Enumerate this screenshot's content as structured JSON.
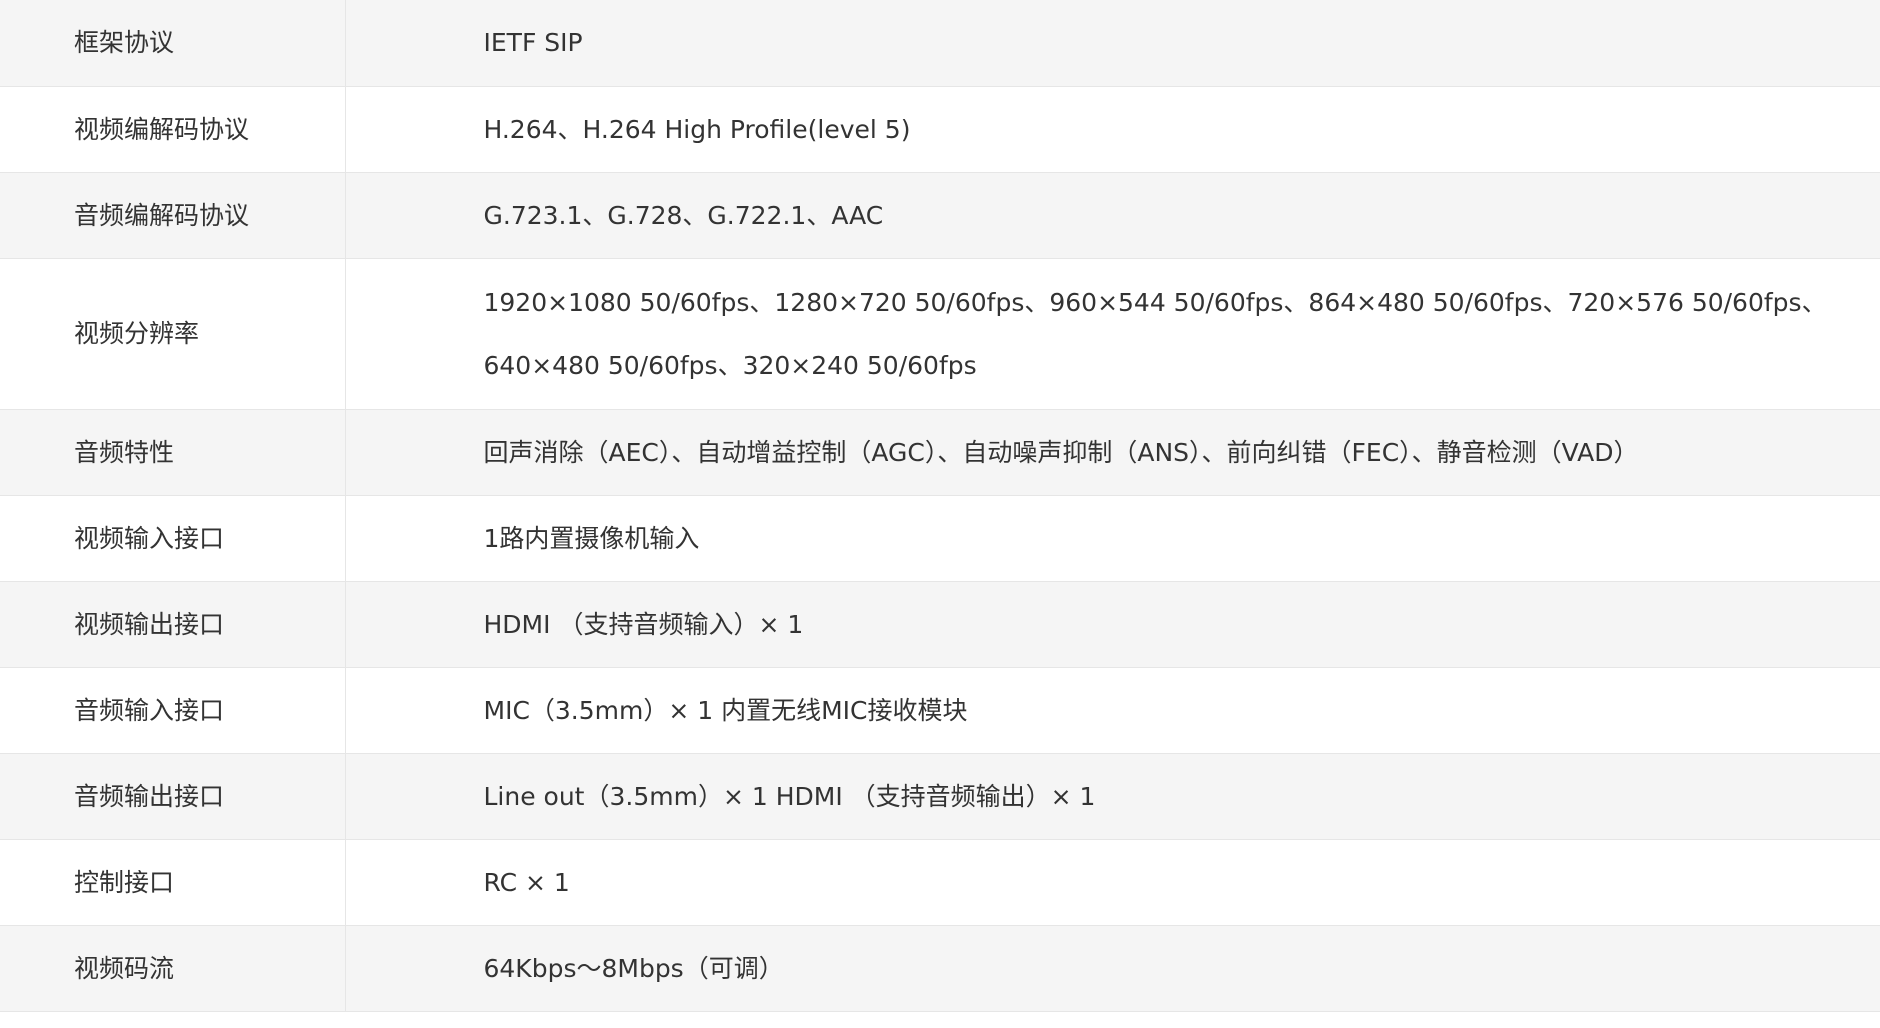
{
  "specs": [
    {
      "label": "框架协议",
      "value": "IETF SIP"
    },
    {
      "label": "视频编解码协议",
      "value": "H.264、H.264 High Profile(level 5)"
    },
    {
      "label": "音频编解码协议",
      "value": "G.723.1、G.728、G.722.1、AAC"
    },
    {
      "label": "视频分辨率",
      "value": "1920×1080 50/60fps、1280×720 50/60fps、960×544 50/60fps、864×480 50/60fps、720×576 50/60fps、640×480 50/60fps、320×240 50/60fps"
    },
    {
      "label": "音频特性",
      "value": "回声消除（AEC）、自动增益控制（AGC）、自动噪声抑制（ANS）、前向纠错（FEC）、静音检测（VAD）"
    },
    {
      "label": "视频输入接口",
      "value": "1路内置摄像机输入"
    },
    {
      "label": "视频输出接口",
      "value": "HDMI （支持音频输入）× 1"
    },
    {
      "label": "音频输入接口",
      "value": "MIC（3.5mm）× 1 内置无线MIC接收模块"
    },
    {
      "label": "音频输出接口",
      "value": "Line out（3.5mm）× 1 HDMI （支持音频输出）× 1"
    },
    {
      "label": "控制接口",
      "value": "RC × 1"
    },
    {
      "label": "视频码流",
      "value": "64Kbps～8Mbps（可调）"
    }
  ]
}
